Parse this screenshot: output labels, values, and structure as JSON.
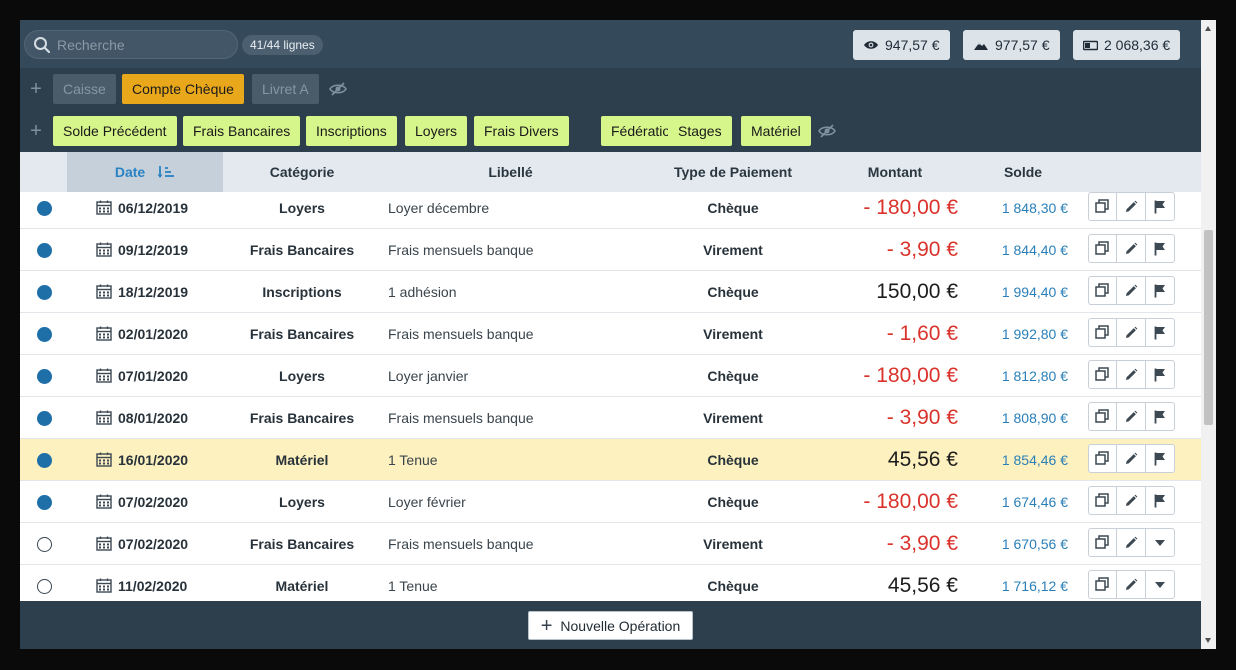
{
  "search": {
    "placeholder": "Recherche",
    "value": "",
    "count": "41/44 lignes"
  },
  "totals": [
    {
      "icon": "eye-icon",
      "value": "947,57 €"
    },
    {
      "icon": "mountain-icon",
      "value": "977,57 €"
    },
    {
      "icon": "wallet-icon",
      "value": "2 068,36 €"
    }
  ],
  "accounts": {
    "items": [
      {
        "label": "Caisse",
        "active": false
      },
      {
        "label": "Compte Chèque",
        "active": true
      },
      {
        "label": "Livret A",
        "active": false
      }
    ]
  },
  "categories": {
    "items": [
      "Solde Précédent",
      "Frais Bancaires",
      "Inscriptions",
      "Loyers",
      "Frais Divers",
      "Fédération",
      "Stages",
      "Matériel"
    ]
  },
  "table": {
    "headers": {
      "date": "Date",
      "category": "Catégorie",
      "label": "Libellé",
      "payment": "Type de Paiement",
      "amount": "Montant",
      "balance": "Solde"
    },
    "rows": [
      {
        "checked": true,
        "date": "06/12/2019",
        "category": "Loyers",
        "label": "Loyer décembre",
        "payment": "Chèque",
        "amount": "- 180,00 €",
        "negative": true,
        "balance": "1 848,30 €",
        "flag": "flag",
        "selected": false
      },
      {
        "checked": true,
        "date": "09/12/2019",
        "category": "Frais Bancaires",
        "label": "Frais mensuels banque",
        "payment": "Virement",
        "amount": "- 3,90 €",
        "negative": true,
        "balance": "1 844,40 €",
        "flag": "flag",
        "selected": false
      },
      {
        "checked": true,
        "date": "18/12/2019",
        "category": "Inscriptions",
        "label": "1 adhésion",
        "payment": "Chèque",
        "amount": "150,00 €",
        "negative": false,
        "balance": "1 994,40 €",
        "flag": "flag",
        "selected": false
      },
      {
        "checked": true,
        "date": "02/01/2020",
        "category": "Frais Bancaires",
        "label": "Frais mensuels banque",
        "payment": "Virement",
        "amount": "- 1,60 €",
        "negative": true,
        "balance": "1 992,80 €",
        "flag": "flag",
        "selected": false
      },
      {
        "checked": true,
        "date": "07/01/2020",
        "category": "Loyers",
        "label": "Loyer janvier",
        "payment": "Chèque",
        "amount": "- 180,00 €",
        "negative": true,
        "balance": "1 812,80 €",
        "flag": "flag",
        "selected": false
      },
      {
        "checked": true,
        "date": "08/01/2020",
        "category": "Frais Bancaires",
        "label": "Frais mensuels banque",
        "payment": "Virement",
        "amount": "- 3,90 €",
        "negative": true,
        "balance": "1 808,90 €",
        "flag": "flag",
        "selected": false
      },
      {
        "checked": true,
        "date": "16/01/2020",
        "category": "Matériel",
        "label": "1 Tenue",
        "payment": "Chèque",
        "amount": "45,56 €",
        "negative": false,
        "balance": "1 854,46 €",
        "flag": "flag",
        "selected": true
      },
      {
        "checked": true,
        "date": "07/02/2020",
        "category": "Loyers",
        "label": "Loyer février",
        "payment": "Chèque",
        "amount": "- 180,00 €",
        "negative": true,
        "balance": "1 674,46 €",
        "flag": "flag",
        "selected": false
      },
      {
        "checked": false,
        "date": "07/02/2020",
        "category": "Frais Bancaires",
        "label": "Frais mensuels banque",
        "payment": "Virement",
        "amount": "- 3,90 €",
        "negative": true,
        "balance": "1 670,56 €",
        "flag": "caret",
        "selected": false
      },
      {
        "checked": false,
        "date": "11/02/2020",
        "category": "Matériel",
        "label": "1 Tenue",
        "payment": "Chèque",
        "amount": "45,56 €",
        "negative": false,
        "balance": "1 716,12 €",
        "flag": "caret",
        "selected": false
      }
    ]
  },
  "footer": {
    "new_operation": "Nouvelle Opération"
  },
  "colors": {
    "accent_account": "#e9a81c",
    "category_chip": "#d6f58a",
    "negative": "#d9332b",
    "balance": "#2a7fb8",
    "selected_row": "#fdf1bf"
  }
}
